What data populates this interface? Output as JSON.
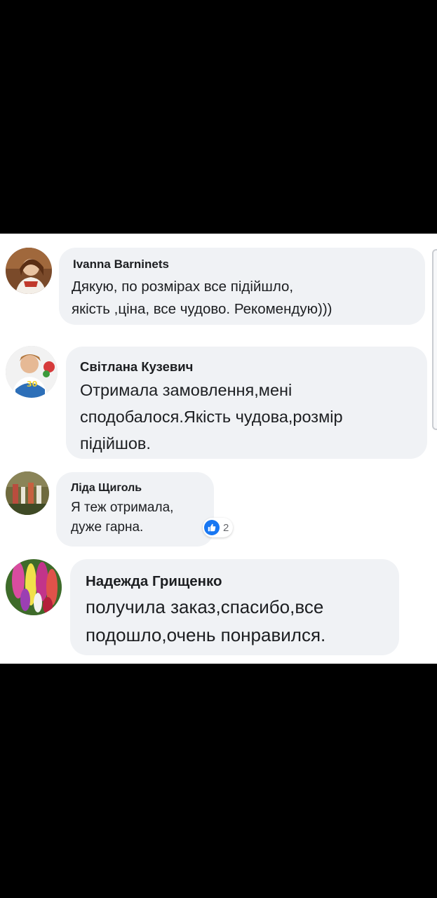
{
  "comments": [
    {
      "name": "Ivanna Barninets",
      "lines": [
        "Дякую, по розмірах все підійшло,",
        "якість ,ціна, все чудово. Рекомендую)))"
      ]
    },
    {
      "name": "Світлана Кузевич",
      "lines": [
        "Отримала замовлення,мені",
        "сподобалося.Якість чудова,розмір",
        "підійшов."
      ]
    },
    {
      "name": "Ліда Щиголь",
      "lines": [
        "Я теж отримала,",
        "дуже гарна."
      ],
      "reaction": {
        "icon": "like-icon",
        "count": "2"
      }
    },
    {
      "name": "Надежда Грищенко",
      "lines": [
        "получила заказ,спасибо,все",
        "подошло,очень понравился."
      ]
    }
  ],
  "colors": {
    "background": "#000000",
    "panel": "#ffffff",
    "bubble": "#f0f2f5",
    "text": "#1c1e21",
    "like": "#1877f2"
  }
}
